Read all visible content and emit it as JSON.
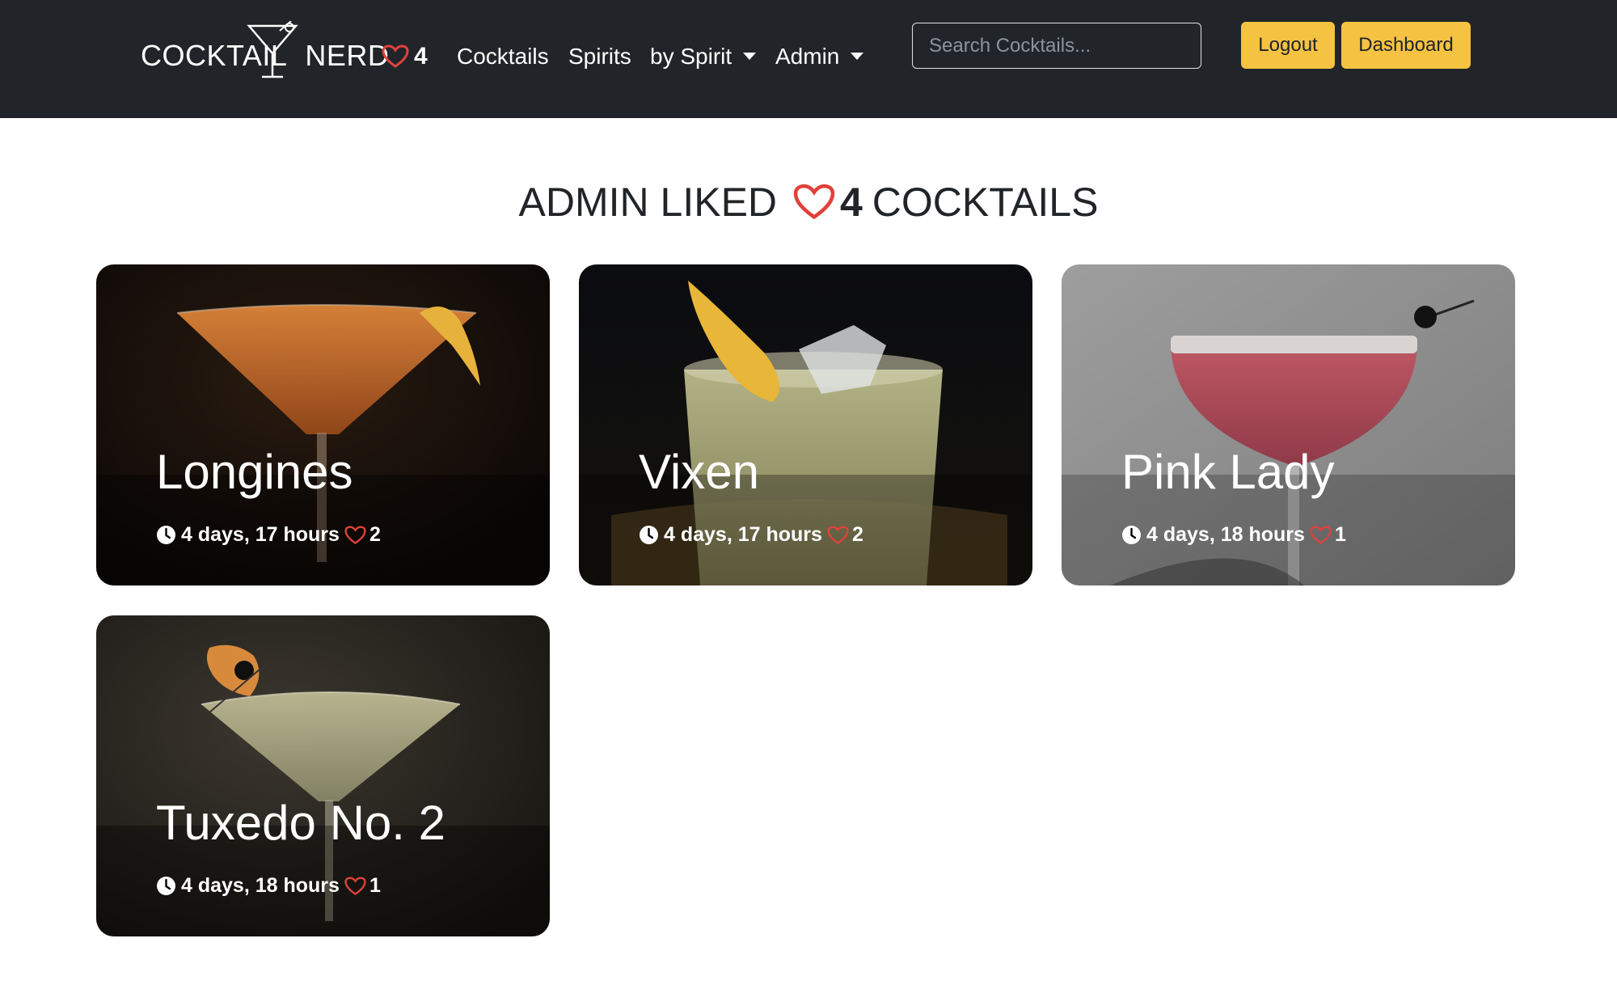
{
  "brand": {
    "part1": "COCKTAIL",
    "part2": "NERD"
  },
  "nav": {
    "likes_count": "4",
    "links": [
      "Cocktails",
      "Spirits",
      "by Spirit",
      "Admin"
    ],
    "search_placeholder": "Search Cocktails...",
    "logout_label": "Logout",
    "dashboard_label": "Dashboard"
  },
  "heading": {
    "prefix": "ADMIN LIKED",
    "count": "4",
    "suffix": "COCKTAILS"
  },
  "cards": [
    {
      "title": "Longines",
      "time": "4 days, 17 hours",
      "likes": "2"
    },
    {
      "title": "Vixen",
      "time": "4 days, 17 hours",
      "likes": "2"
    },
    {
      "title": "Pink Lady",
      "time": "4 days, 18 hours",
      "likes": "1"
    },
    {
      "title": "Tuxedo No. 2",
      "time": "4 days, 18 hours",
      "likes": "1"
    }
  ],
  "colors": {
    "navbar_bg": "#212529",
    "accent_button": "#f5c242",
    "heart": "#e0413b"
  },
  "icons": [
    "martini-glass-icon",
    "heart-icon",
    "caret-down-icon",
    "clock-icon"
  ]
}
